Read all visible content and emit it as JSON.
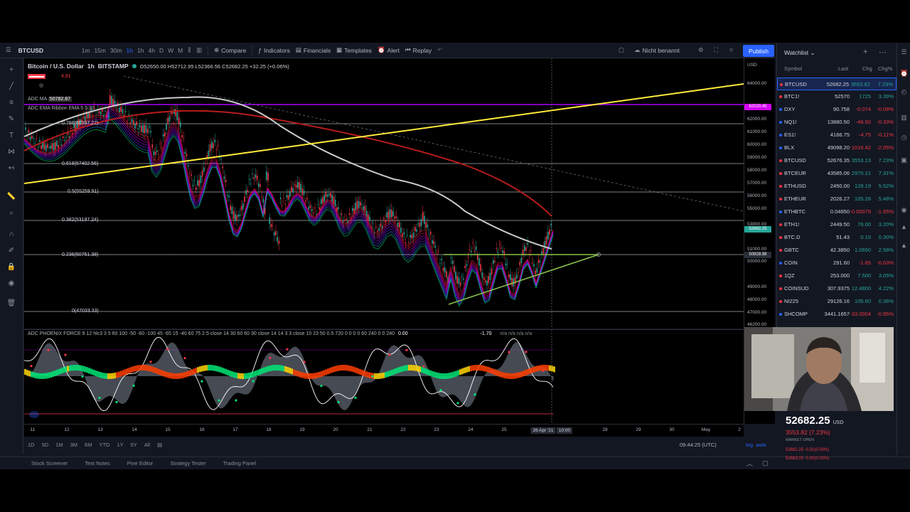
{
  "toolbar": {
    "symbol": "BTCUSD",
    "intervals": [
      "1m",
      "15m",
      "30m",
      "1h",
      "1h",
      "4h",
      "D",
      "W",
      "M"
    ],
    "compare_label": "Compare",
    "indicators_label": "Indicators",
    "financials_label": "Financials",
    "templates_label": "Templates",
    "alert_label": "Alert",
    "replay_label": "Replay",
    "layout_name": "Nicht benannt",
    "publish_label": "Publish"
  },
  "chart": {
    "title": "Bitcoin / U.S. Dollar",
    "interval": "1h",
    "exchange": "BITSTAMP",
    "ohlc": "O52650.00  H52712.95  L52366.56  C52682.25  +32.25 (+0.06%)",
    "ind1_name": "ADC MA",
    "ind1_val": "50782.87",
    "ind2_name": "ADC EMA Ribbon EMA 5 5 10",
    "fib_levels": [
      "0.786(60597.22)",
      "0.618(57402.56)",
      "0.5(55259.91)",
      "0.382(53197.24)",
      "0.236(50751.38)",
      "0(47033.33)"
    ],
    "price_ticks": [
      "USD",
      "64000.00",
      "62000.00",
      "61000.00",
      "60000.00",
      "59000.00",
      "58000.00",
      "57000.00",
      "56000.00",
      "55000.00",
      "53800.00",
      "51000.00",
      "50000.00",
      "49000.00",
      "48000.00",
      "47000.00",
      "46200.00"
    ],
    "badge_yellow_line": "62020.45",
    "badge_price": "52682.25",
    "badge_hline": "50828.98",
    "colors": {
      "up": "#26a69a",
      "down": "#f23645",
      "trend_yellow": "#ffeb3b",
      "triangle_green": "#8bc34a",
      "ma_white": "#c9c9c9",
      "ema_red": "#b71c1c",
      "fib_white": "#d1d4dc"
    }
  },
  "oscillator": {
    "label": "ADC PHOENIX FORCE 9 12 hlc3 3 5 60 100 -50 -60 -100 45 -65 15 -40 60 75 2.5 close 14 30 60 60 30 close 14 14 3 3 close 10 23 50 0.5 720 0 0 0 0 60 240 0 0 240",
    "value": "0.00",
    "value2": "-1.70",
    "na_text": "n/a  n/a  n/a  n/a"
  },
  "time_axis": {
    "ticks": [
      "11",
      "12",
      "13",
      "14",
      "15",
      "16",
      "17",
      "18",
      "19",
      "20",
      "21",
      "22",
      "23",
      "24",
      "25",
      "26 Apr '21",
      "10:00",
      "28",
      "29",
      "30",
      "May",
      "2"
    ]
  },
  "range_bar": {
    "ranges": [
      "1D",
      "5D",
      "1M",
      "3M",
      "6M",
      "YTD",
      "1Y",
      "5Y",
      "All"
    ],
    "clock": "09:44:25 (UTC)",
    "log": "log",
    "auto": "auto"
  },
  "bottom_tabs": [
    "Stock Screener",
    "Text Notes",
    "Pine Editor",
    "Strategy Tester",
    "Trading Panel"
  ],
  "watchlist": {
    "title": "Watchlist",
    "headers": {
      "symbol": "Symbol",
      "last": "Last",
      "chg": "Chg",
      "chgp": "Chg%"
    },
    "rows": [
      {
        "symbol": "BTCUSD",
        "last": "52682.25",
        "chg": "3553.82",
        "chgp": "7.23%",
        "dir": "pos",
        "sel": true
      },
      {
        "symbol": "BTC1!",
        "last": "52570",
        "chg": "1725",
        "chgp": "3.39%",
        "dir": "pos",
        "sel": false
      },
      {
        "symbol": "DXY",
        "last": "90.758",
        "chg": "-0.074",
        "chgp": "-0.08%",
        "dir": "neg",
        "sel": false
      },
      {
        "symbol": "NQ1!",
        "last": "13880.50",
        "chg": "-46.50",
        "chgp": "-0.33%",
        "dir": "neg",
        "sel": false
      },
      {
        "symbol": "ES1!",
        "last": "4166.75",
        "chg": "-4.75",
        "chgp": "-0.11%",
        "dir": "neg",
        "sel": false
      },
      {
        "symbol": "BLX",
        "last": "49098.20",
        "chg": "-1016.42",
        "chgp": "-2.05%",
        "dir": "neg",
        "sel": false
      },
      {
        "symbol": "BTCUSD",
        "last": "52676.35",
        "chg": "3553.13",
        "chgp": "7.23%",
        "dir": "pos",
        "sel": false
      },
      {
        "symbol": "BTCEUR",
        "last": "43585.06",
        "chg": "2970.21",
        "chgp": "7.31%",
        "dir": "pos",
        "sel": false
      },
      {
        "symbol": "ETHUSD",
        "last": "2450.00",
        "chg": "128.19",
        "chgp": "5.52%",
        "dir": "pos",
        "sel": false
      },
      {
        "symbol": "ETHEUR",
        "last": "2026.27",
        "chg": "105.28",
        "chgp": "5.48%",
        "dir": "pos",
        "sel": false
      },
      {
        "symbol": "ETHBTC",
        "last": "0.04650",
        "chg": "-0.00079",
        "chgp": "-1.65%",
        "dir": "neg",
        "sel": false
      },
      {
        "symbol": "ETH1!",
        "last": "2449.50",
        "chg": "76.00",
        "chgp": "3.20%",
        "dir": "pos",
        "sel": false
      },
      {
        "symbol": "BTC.D",
        "last": "51.43",
        "chg": "0.15",
        "chgp": "0.30%",
        "dir": "pos",
        "sel": false
      },
      {
        "symbol": "GBTC",
        "last": "42.3850",
        "chg": "1.0650",
        "chgp": "2.58%",
        "dir": "pos",
        "sel": false
      },
      {
        "symbol": "COIN",
        "last": "291.60",
        "chg": "-1.85",
        "chgp": "-0.63%",
        "dir": "neg",
        "sel": false
      },
      {
        "symbol": "1QZ",
        "last": "253.000",
        "chg": "7.500",
        "chgp": "3.05%",
        "dir": "pos",
        "sel": false
      },
      {
        "symbol": "COINSUD",
        "last": "307.9375",
        "chg": "12.4800",
        "chgp": "4.22%",
        "dir": "pos",
        "sel": false
      },
      {
        "symbol": "NI225",
        "last": "29126.16",
        "chg": "105.60",
        "chgp": "0.36%",
        "dir": "pos",
        "sel": false
      },
      {
        "symbol": "SHCOMP",
        "last": "3441.1657",
        "chg": "-33.0004",
        "chgp": "-0.95%",
        "dir": "neg",
        "sel": false
      }
    ]
  },
  "ticker_panel": {
    "price": "52682.25",
    "currency": "USD",
    "change": "3553.82 (7.23%)",
    "market": "MARKET OPEN",
    "line1": "52682.25  -0.01(0.00%)",
    "line2": "52683.00  -0.00(0.00%)"
  }
}
